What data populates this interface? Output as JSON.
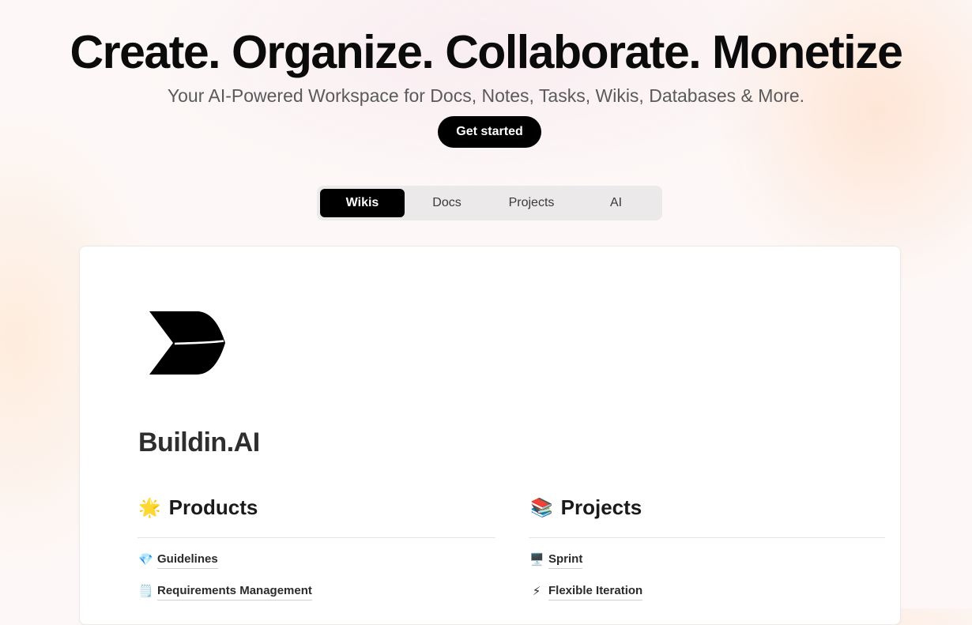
{
  "hero": {
    "title": "Create. Organize. Collaborate. Monetize",
    "subtitle": "Your AI-Powered Workspace for Docs, Notes, Tasks, Wikis, Databases & More.",
    "cta_label": "Get started"
  },
  "tabs": [
    {
      "label": "Wikis",
      "active": true
    },
    {
      "label": "Docs",
      "active": false
    },
    {
      "label": "Projects",
      "active": false
    },
    {
      "label": "AI",
      "active": false
    }
  ],
  "preview": {
    "brand_name": "Buildin.AI",
    "sections": [
      {
        "emoji": "🌟",
        "heading": "Products",
        "items": [
          {
            "emoji": "💎",
            "label": "Guidelines"
          },
          {
            "emoji": "🗒️",
            "label": "Requirements Management"
          }
        ]
      },
      {
        "emoji": "📚",
        "heading": "Projects",
        "items": [
          {
            "emoji": "🖥️",
            "label": "Sprint"
          },
          {
            "emoji": "⚡",
            "label": "Flexible Iteration"
          }
        ]
      }
    ]
  }
}
